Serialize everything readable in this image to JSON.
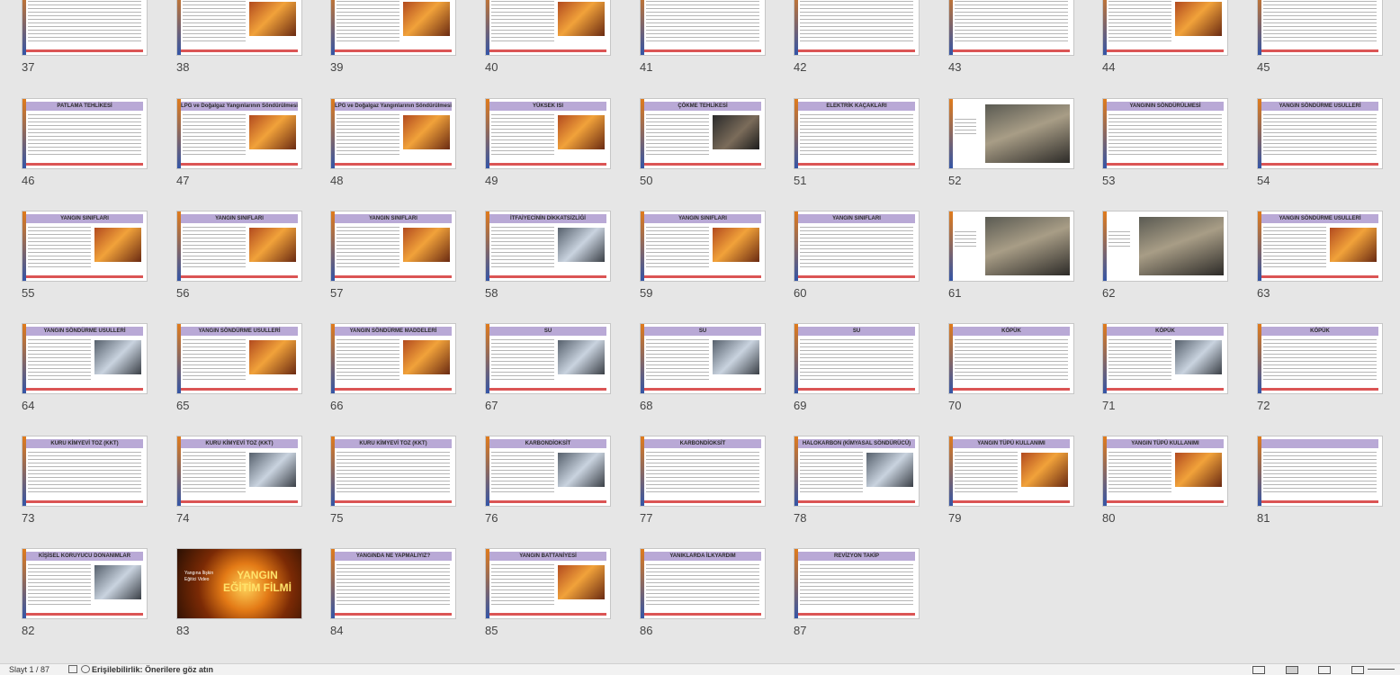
{
  "slides": [
    {
      "n": "37",
      "title": ""
    },
    {
      "n": "38",
      "title": ""
    },
    {
      "n": "39",
      "title": ""
    },
    {
      "n": "40",
      "title": ""
    },
    {
      "n": "41",
      "title": ""
    },
    {
      "n": "42",
      "title": ""
    },
    {
      "n": "43",
      "title": ""
    },
    {
      "n": "44",
      "title": ""
    },
    {
      "n": "45",
      "title": ""
    },
    {
      "n": "46",
      "title": "PATLAMA TEHLİKESİ"
    },
    {
      "n": "47",
      "title": "LPG ve Doğalgaz Yangınlarının Söndürülmesi"
    },
    {
      "n": "48",
      "title": "LPG ve Doğalgaz Yangınlarının Söndürülmesi"
    },
    {
      "n": "49",
      "title": "YÜKSEK ISI"
    },
    {
      "n": "50",
      "title": "ÇÖKME TEHLİKESİ"
    },
    {
      "n": "51",
      "title": "ELEKTRİK KAÇAKLARI"
    },
    {
      "n": "52",
      "title": ""
    },
    {
      "n": "53",
      "title": "YANGININ SÖNDÜRÜLMESİ"
    },
    {
      "n": "54",
      "title": "YANGIN SÖNDÜRME USULLERİ"
    },
    {
      "n": "55",
      "title": "YANGIN SINIFLARI"
    },
    {
      "n": "56",
      "title": "YANGIN SINIFLARI"
    },
    {
      "n": "57",
      "title": "YANGIN SINIFLARI"
    },
    {
      "n": "58",
      "title": "İTFAİYECİNİN DİKKATSİZLİĞİ"
    },
    {
      "n": "59",
      "title": "YANGIN SINIFLARI"
    },
    {
      "n": "60",
      "title": "YANGIN SINIFLARI"
    },
    {
      "n": "61",
      "title": ""
    },
    {
      "n": "62",
      "title": ""
    },
    {
      "n": "63",
      "title": "YANGIN SÖNDÜRME USULLERİ"
    },
    {
      "n": "64",
      "title": "YANGIN SÖNDÜRME USULLERİ"
    },
    {
      "n": "65",
      "title": "YANGIN SÖNDÜRME USULLERİ"
    },
    {
      "n": "66",
      "title": "YANGIN SÖNDÜRME MADDELERİ"
    },
    {
      "n": "67",
      "title": "SU"
    },
    {
      "n": "68",
      "title": "SU"
    },
    {
      "n": "69",
      "title": "SU"
    },
    {
      "n": "70",
      "title": "KÖPÜK"
    },
    {
      "n": "71",
      "title": "KÖPÜK"
    },
    {
      "n": "72",
      "title": "KÖPÜK"
    },
    {
      "n": "73",
      "title": "KURU KİMYEVİ TOZ (KKT)"
    },
    {
      "n": "74",
      "title": "KURU KİMYEVİ TOZ (KKT)"
    },
    {
      "n": "75",
      "title": "KURU KİMYEVİ TOZ (KKT)"
    },
    {
      "n": "76",
      "title": "KARBONDİOKSİT"
    },
    {
      "n": "77",
      "title": "KARBONDİOKSİT"
    },
    {
      "n": "78",
      "title": "HALOKARBON (KİMYASAL SÖNDÜRÜCÜ)"
    },
    {
      "n": "79",
      "title": "YANGIN TÜPÜ KULLANIMI"
    },
    {
      "n": "80",
      "title": "YANGIN TÜPÜ KULLANIMI"
    },
    {
      "n": "81",
      "title": ""
    },
    {
      "n": "82",
      "title": "KİŞİSEL KORUYUCU DONANIMLAR"
    },
    {
      "n": "83",
      "title": ""
    },
    {
      "n": "84",
      "title": "YANGINDA NE YAPMALIYIZ?"
    },
    {
      "n": "85",
      "title": "YANGIN BATTANİYESİ"
    },
    {
      "n": "86",
      "title": "YANIKLARDA İLKYARDIM"
    },
    {
      "n": "87",
      "title": "REVİZYON TAKİP"
    }
  ],
  "video_slide": {
    "big_text": "YANGIN EĞİTİM FİLMİ",
    "label": "Yangına İlişkin Eğitici Video"
  },
  "status": {
    "slide_counter": "Slayt 1 / 87",
    "accessibility": "Erişilebilirlik: Önerilere göz atın"
  }
}
